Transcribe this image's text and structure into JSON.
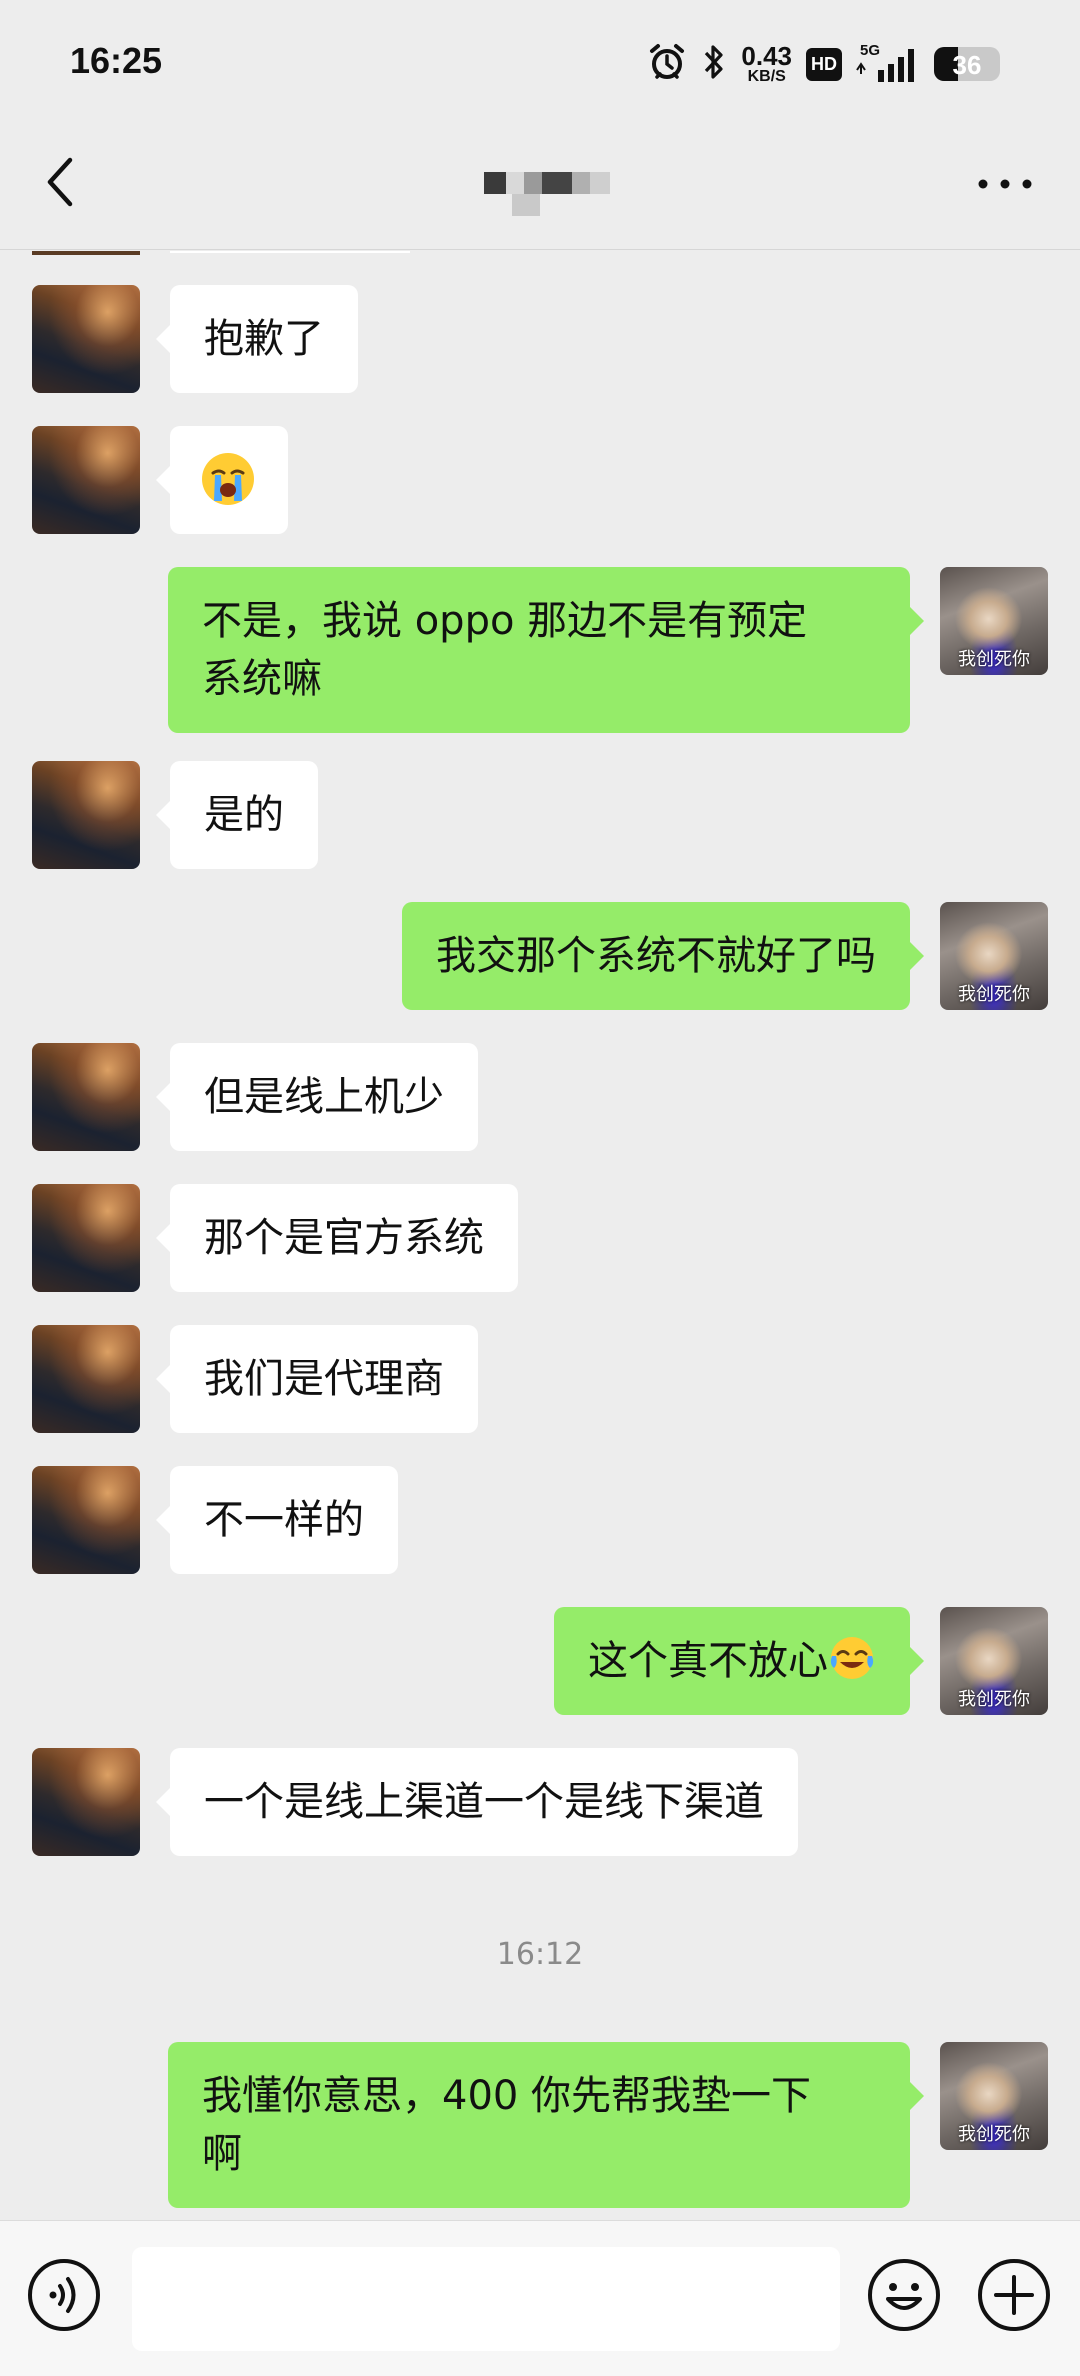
{
  "status_bar": {
    "time": "16:25",
    "net_speed_value": "0.43",
    "net_speed_unit": "KB/S",
    "hd_label": "HD",
    "signal_label": "5G",
    "battery_level": "36",
    "battery_fraction": 0.36
  },
  "nav": {
    "back_icon": "chevron-left-icon",
    "title_obscured": true,
    "more_icon": "more-dots-icon"
  },
  "self_avatar_caption": "我创死你",
  "messages": [
    {
      "side": "left",
      "text": "抱歉了"
    },
    {
      "side": "left",
      "emoji": "loudly-crying-face-icon"
    },
    {
      "side": "right",
      "line1": "不是，我说 oppo 那边不是有预定",
      "line2": "系统嘛"
    },
    {
      "side": "left",
      "text": "是的"
    },
    {
      "side": "right",
      "text": "我交那个系统不就好了吗"
    },
    {
      "side": "left",
      "text": "但是线上机少"
    },
    {
      "side": "left",
      "text": "那个是官方系统"
    },
    {
      "side": "left",
      "text": "我们是代理商"
    },
    {
      "side": "left",
      "text": "不一样的"
    },
    {
      "side": "right",
      "text": "这个真不放心",
      "trailing_emoji": "tears-of-joy-face-icon"
    },
    {
      "side": "left",
      "text": "一个是线上渠道一个是线下渠道"
    },
    {
      "type": "timestamp",
      "text": "16:12"
    },
    {
      "side": "right",
      "line1": "我懂你意思，400 你先帮我垫一下",
      "line2": "啊"
    }
  ],
  "input_bar": {
    "voice_icon": "voice-icon",
    "input_value": "",
    "emoji_icon": "emoji-icon",
    "plus_icon": "plus-icon"
  },
  "colors": {
    "background": "#ededed",
    "self_bubble": "#95ec69",
    "peer_bubble": "#ffffff",
    "timestamp_text": "#8a8a8a"
  }
}
